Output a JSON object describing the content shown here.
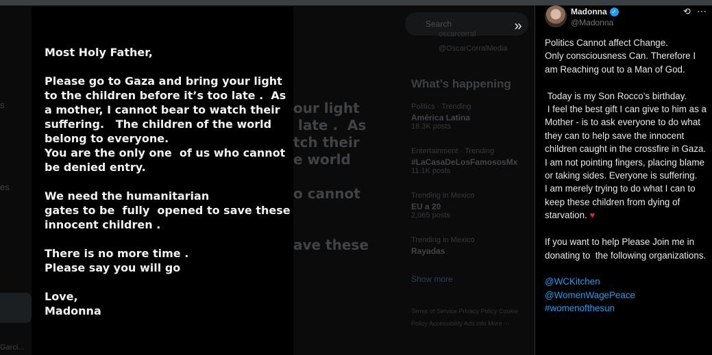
{
  "viewer": {
    "edge_text": [
      "s",
      "es",
      "Garci..."
    ],
    "background_timeline": {
      "search_placeholder": "Search",
      "profile_line1": "oscarcorral",
      "profile_line2": "@OscarCorralMedia",
      "heading": "What’s happening",
      "trends": [
        {
          "context": "Politics · Trending",
          "name": "América Latina",
          "posts": "18.3K posts"
        },
        {
          "context": "Entertainment · Trending",
          "name": "#LaCasaDeLosFamososMx",
          "posts": "11.1K posts"
        },
        {
          "context": "Trending in Mexico",
          "name": "EU a 20",
          "posts": "2,065 posts"
        },
        {
          "context": "Trending in Mexico",
          "name": "Rayadas",
          "posts": ""
        }
      ],
      "show_more": "Show more",
      "footer": "Terms of Service   Privacy Policy   Cookie Policy   Accessibility   Ads info   More ···"
    },
    "expand_icon": "»"
  },
  "letter": {
    "text": "Most Holy Father,\n\nPlease go to Gaza and bring your light\nto the children before it’s too late .  As\na mother, I cannot bear to watch their\nsuffering.   The children of the world\nbelong to everyone.\nYou are the only one  of us who cannot\nbe denied entry.\n\nWe need the humanitarian\ngates to be  fully  opened to save these\ninnocent children .\n\nThere is no more time .\nPlease say you will go\n\nLove,\nMadonna",
    "ghost": "our light\n late .  As\ntch their\ne world\n\no cannot\n\n\nave these"
  },
  "tweet": {
    "display_name": "Madonna",
    "handle": "@Madonna",
    "verified": true,
    "paragraphs": [
      "Politics Cannot affect Change.\nOnly consciousness Can. Therefore I am Reaching out to a Man of God.",
      " Today is my Son Rocco’s birthday.\n I feel the best gift I can give to him as a Mother - is to ask everyone to do what they can to help save the innocent children caught in the crossfire in Gaza.\nI am not pointing fingers, placing blame or taking sides. Everyone is suffering.\nI am merely trying to do what I can to keep these children from dying of starvation.",
      "If you want to help Please Join me in donating to  the following organizations."
    ],
    "heart_emoji": "♥",
    "mentions": [
      "@WCKitchen",
      "@WomenWagePeace",
      "#womenofthesun"
    ]
  },
  "colors": {
    "accent": "#1d9bf0",
    "background": "#000000",
    "muted": "#71767b"
  }
}
